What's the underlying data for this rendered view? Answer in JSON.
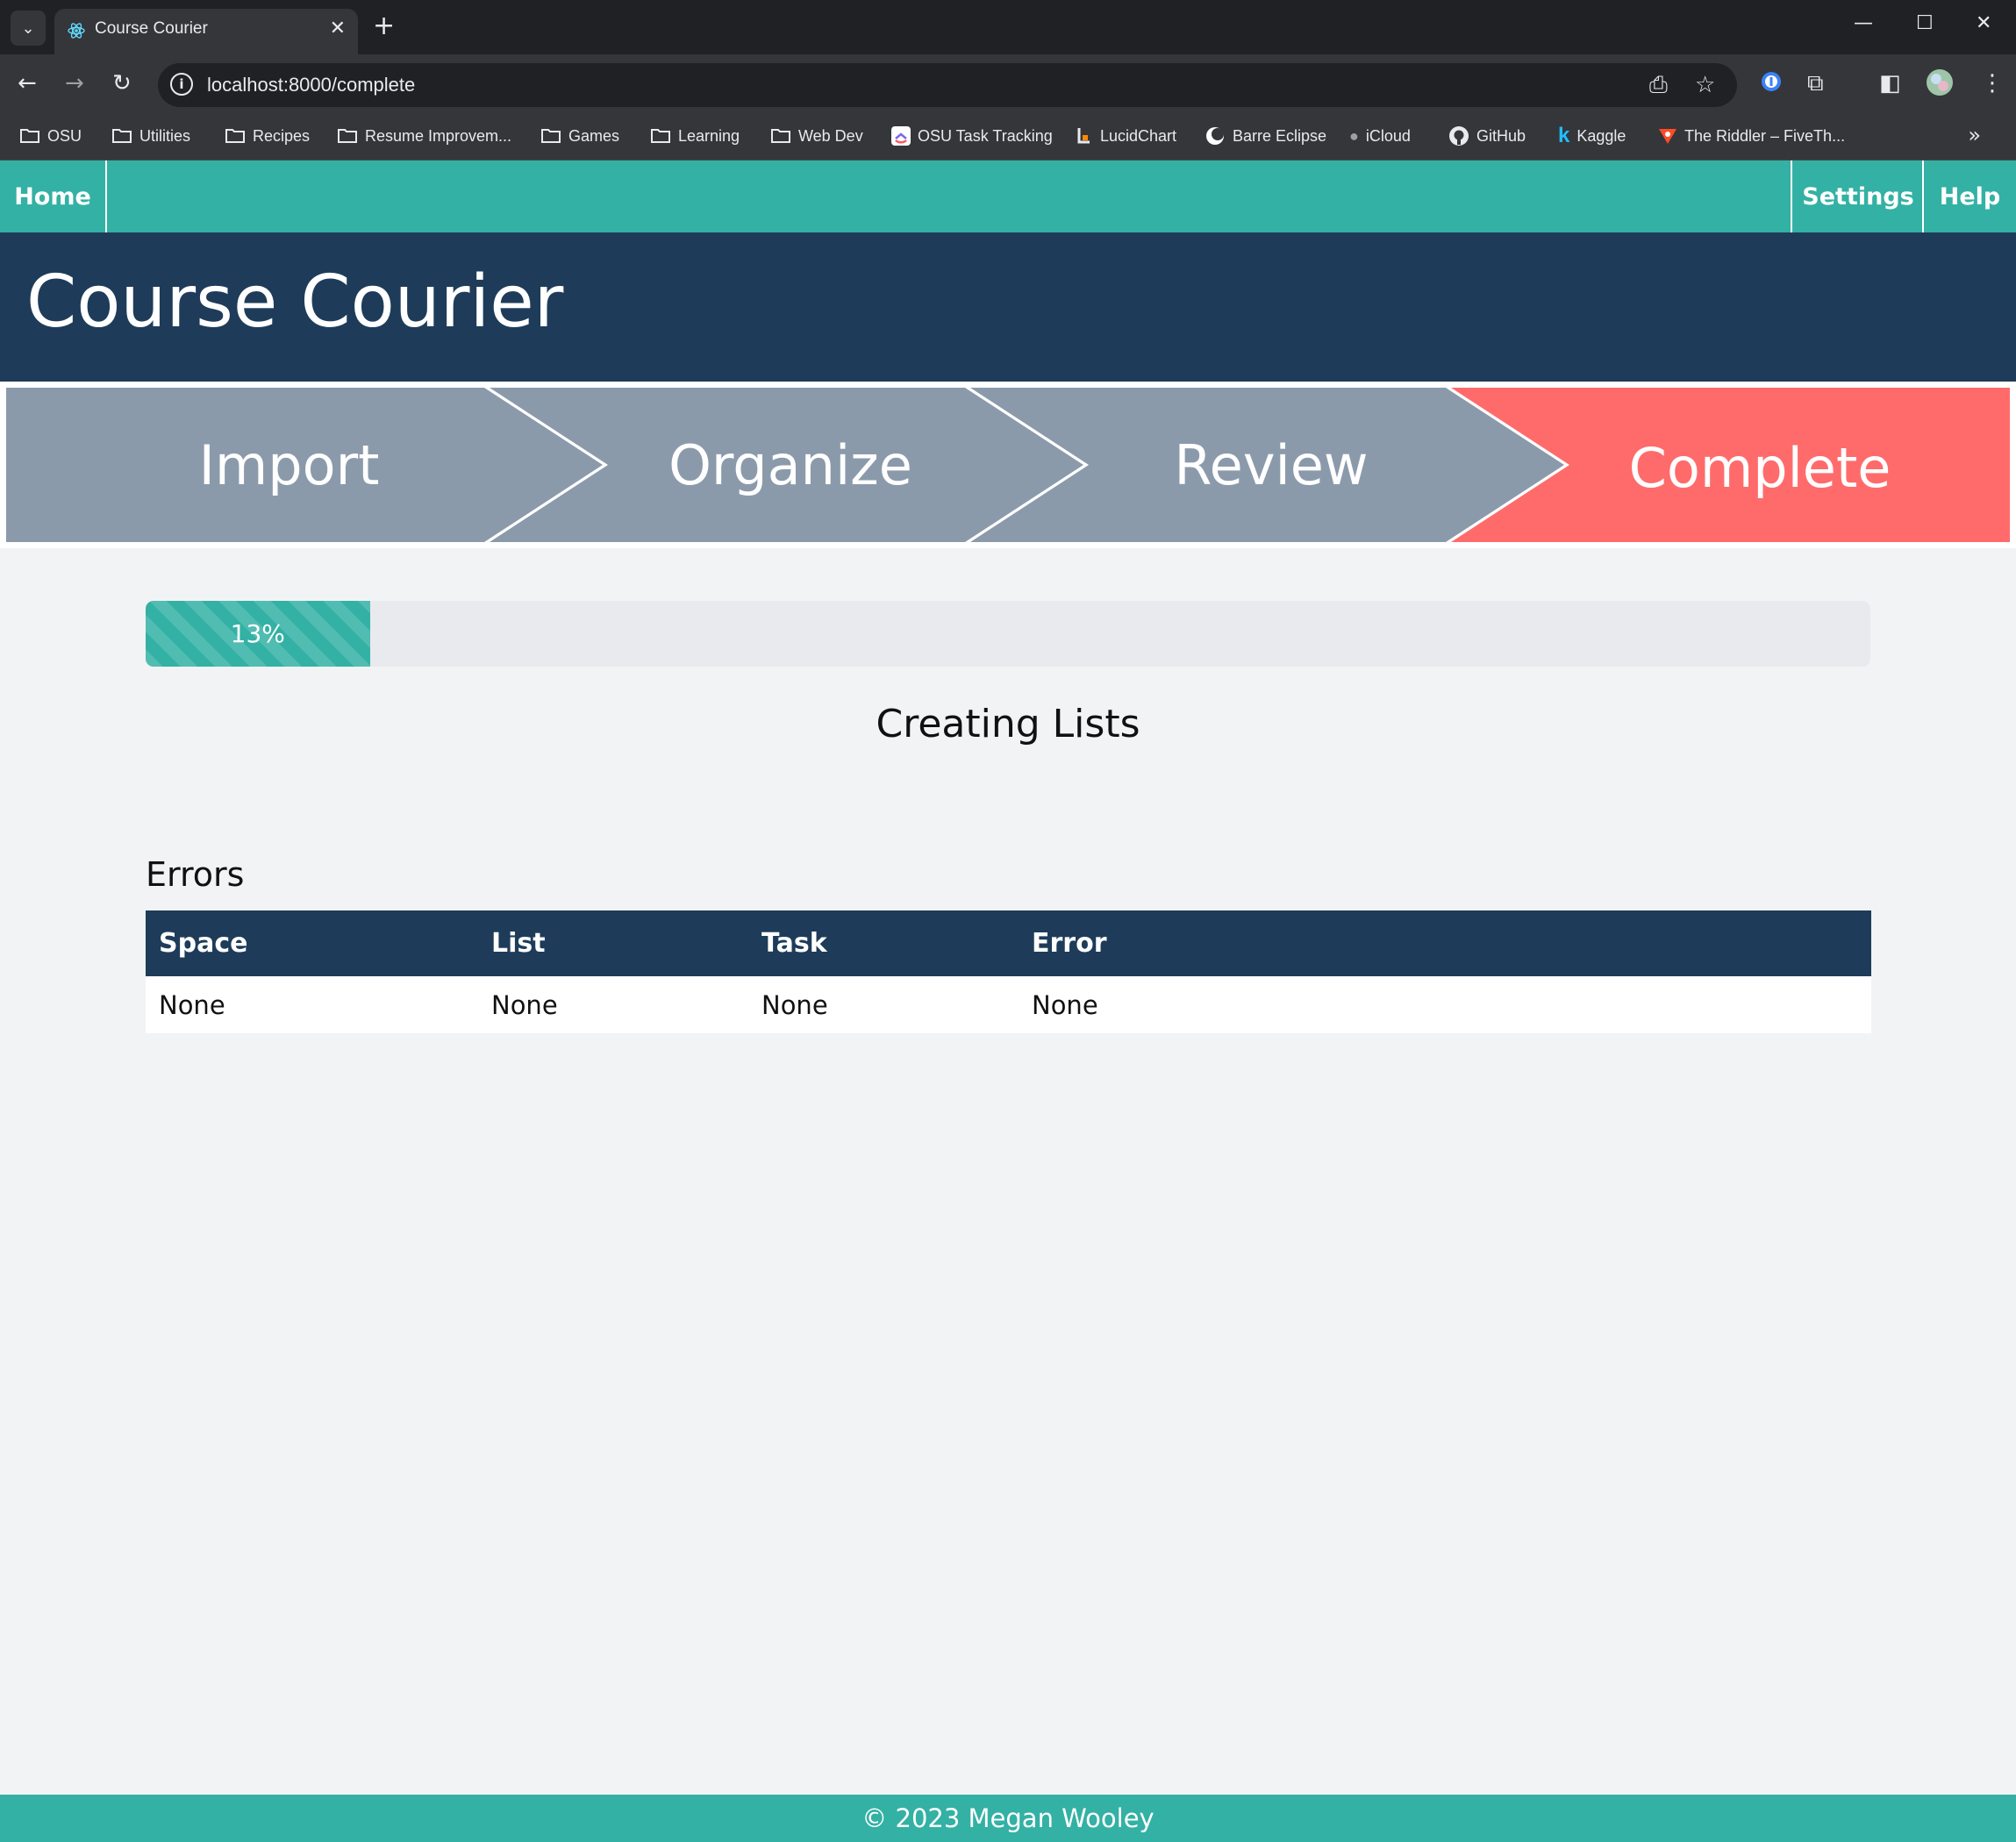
{
  "browser": {
    "tab_title": "Course Courier",
    "url": "localhost:8000/complete",
    "bookmarks": [
      {
        "label": "OSU",
        "icon": "folder-icon"
      },
      {
        "label": "Utilities",
        "icon": "folder-icon"
      },
      {
        "label": "Recipes",
        "icon": "folder-icon"
      },
      {
        "label": "Resume Improvem...",
        "icon": "folder-icon"
      },
      {
        "label": "Games",
        "icon": "folder-icon"
      },
      {
        "label": "Learning",
        "icon": "folder-icon"
      },
      {
        "label": "Web Dev",
        "icon": "folder-icon"
      },
      {
        "label": "OSU Task Tracking",
        "icon": "clickup-icon"
      },
      {
        "label": "LucidChart",
        "icon": "lucidchart-icon"
      },
      {
        "label": "Barre Eclipse",
        "icon": "barre-eclipse-icon"
      },
      {
        "label": "iCloud",
        "icon": "apple-icon"
      },
      {
        "label": "GitHub",
        "icon": "github-icon"
      },
      {
        "label": "Kaggle",
        "icon": "kaggle-icon"
      },
      {
        "label": "The Riddler – FiveTh...",
        "icon": "fivethirtyeight-icon"
      }
    ]
  },
  "nav": {
    "home": "Home",
    "settings": "Settings",
    "help": "Help"
  },
  "banner": {
    "title": "Course Courier"
  },
  "steps": [
    {
      "label": "Import",
      "state": "done"
    },
    {
      "label": "Organize",
      "state": "done"
    },
    {
      "label": "Review",
      "state": "done"
    },
    {
      "label": "Complete",
      "state": "active"
    }
  ],
  "colors": {
    "teal": "#33b1a4",
    "navy": "#1e3c5a",
    "step_inactive": "#8b9aab",
    "step_active": "#ff6b6b"
  },
  "progress": {
    "percent": 13,
    "label": "13%"
  },
  "status": "Creating Lists",
  "errors": {
    "heading": "Errors",
    "columns": [
      "Space",
      "List",
      "Task",
      "Error"
    ],
    "rows": [
      [
        "None",
        "None",
        "None",
        "None"
      ]
    ]
  },
  "footer": "© 2023 Megan Wooley"
}
